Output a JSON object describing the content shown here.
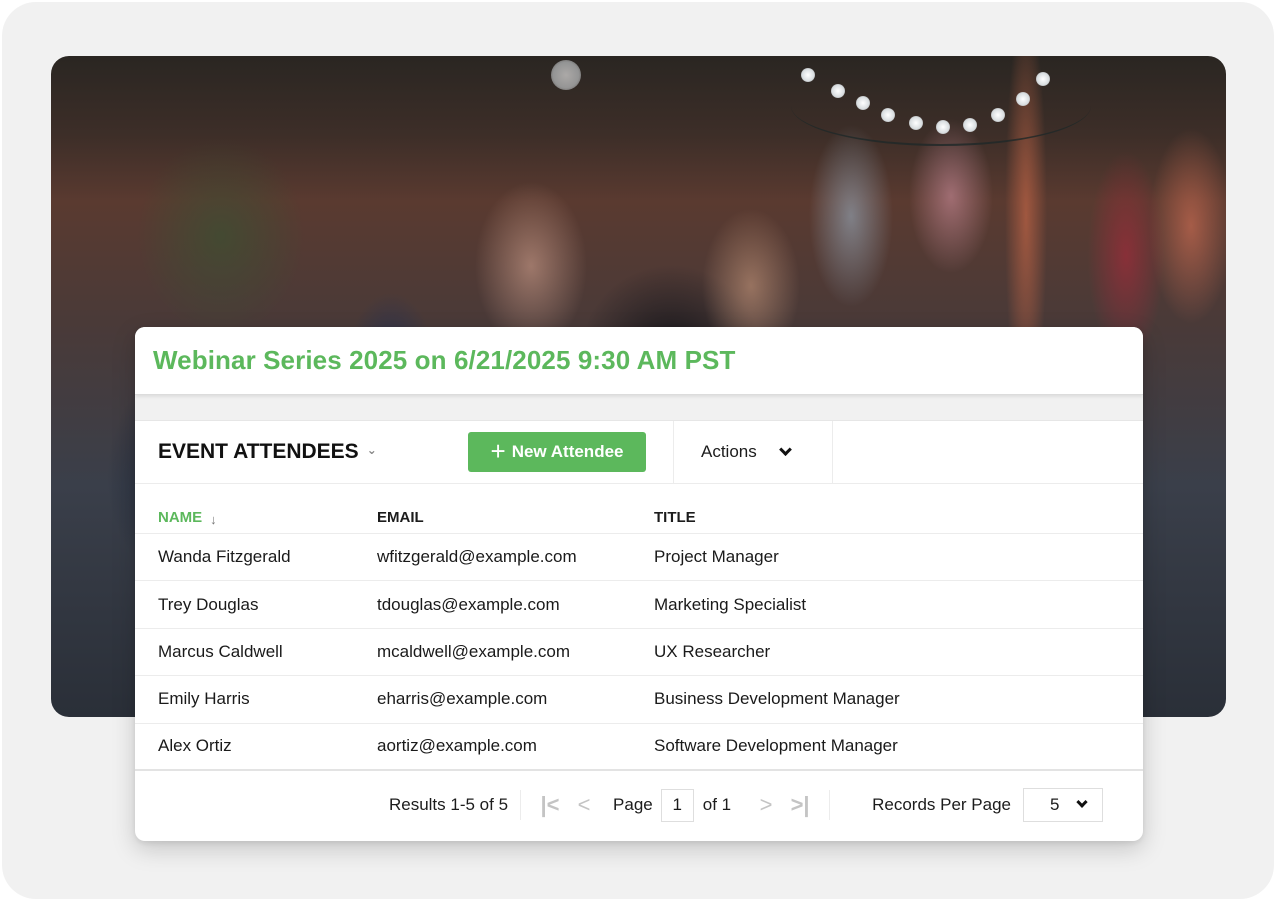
{
  "event": {
    "title": "Webinar Series 2025 on 6/21/2025 9:30 AM PST"
  },
  "toolbar": {
    "section_title": "EVENT ATTENDEES",
    "section_caret_icon": "chevron-down-icon",
    "new_button_icon": "plus-icon",
    "new_button_label": "New Attendee",
    "actions_label": "Actions",
    "actions_icon": "chevron-down-icon"
  },
  "table": {
    "columns": [
      {
        "label": "NAME",
        "sorted": "descending",
        "sort_icon": "arrow-down-icon"
      },
      {
        "label": "EMAIL"
      },
      {
        "label": "TITLE"
      }
    ],
    "rows": [
      {
        "name": "Wanda Fitzgerald",
        "email": "wfitzgerald@example.com",
        "title": "Project Manager"
      },
      {
        "name": "Trey Douglas",
        "email": "tdouglas@example.com",
        "title": "Marketing Specialist"
      },
      {
        "name": "Marcus Caldwell",
        "email": "mcaldwell@example.com",
        "title": "UX Researcher"
      },
      {
        "name": "Emily Harris",
        "email": "eharris@example.com",
        "title": "Business Development Manager"
      },
      {
        "name": "Alex Ortiz",
        "email": "aortiz@example.com",
        "title": "Software Development Manager"
      }
    ]
  },
  "pagination": {
    "results_text": "Results 1-5 of 5",
    "page_label": "Page",
    "current_page": "1",
    "of_text": "of 1",
    "records_per_page_label": "Records Per Page",
    "records_per_page_value": "5",
    "icons": {
      "first": "first-page-icon",
      "prev": "previous-page-icon",
      "next": "next-page-icon",
      "last": "last-page-icon"
    }
  },
  "colors": {
    "accent": "#5cb85c",
    "frame_background": "#f1f1f1",
    "disabled_icon": "#c4c4c4"
  },
  "background_image": {
    "description": "blurred crowd of smiling people at an outdoor event with string lights"
  }
}
